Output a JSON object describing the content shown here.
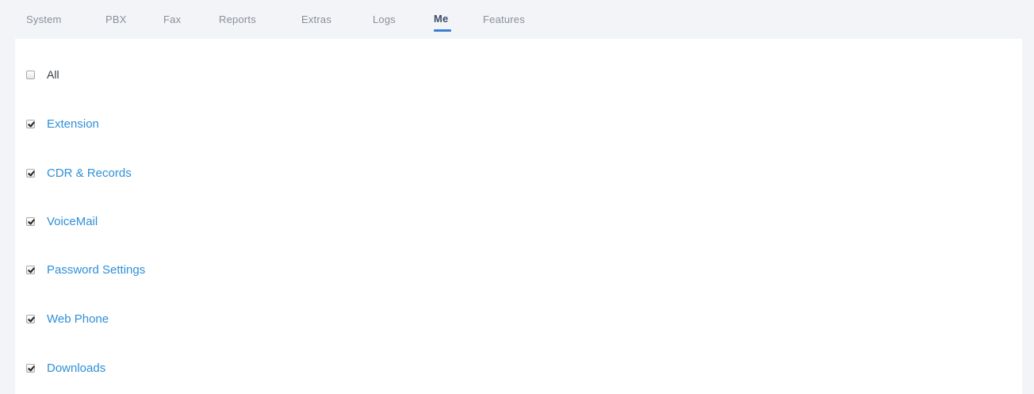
{
  "tabs": [
    {
      "label": "System"
    },
    {
      "label": "PBX"
    },
    {
      "label": "Fax"
    },
    {
      "label": "Reports"
    },
    {
      "label": "Extras"
    },
    {
      "label": "Logs"
    },
    {
      "label": "Me",
      "active": true
    },
    {
      "label": "Features"
    }
  ],
  "permissions": {
    "all": {
      "label": "All",
      "checked": false
    },
    "items": [
      {
        "label": "Extension",
        "checked": true
      },
      {
        "label": "CDR & Records",
        "checked": true
      },
      {
        "label": "VoiceMail",
        "checked": true
      },
      {
        "label": "Password Settings",
        "checked": true
      },
      {
        "label": "Web Phone",
        "checked": true
      },
      {
        "label": "Downloads",
        "checked": true
      }
    ]
  },
  "colors": {
    "accent": "#3a7fd5",
    "link": "#2f8fd6",
    "tab_inactive": "#8a8f99",
    "tab_active": "#3d4a6b",
    "page_bg": "#f2f4f7",
    "panel_bg": "#ffffff"
  }
}
